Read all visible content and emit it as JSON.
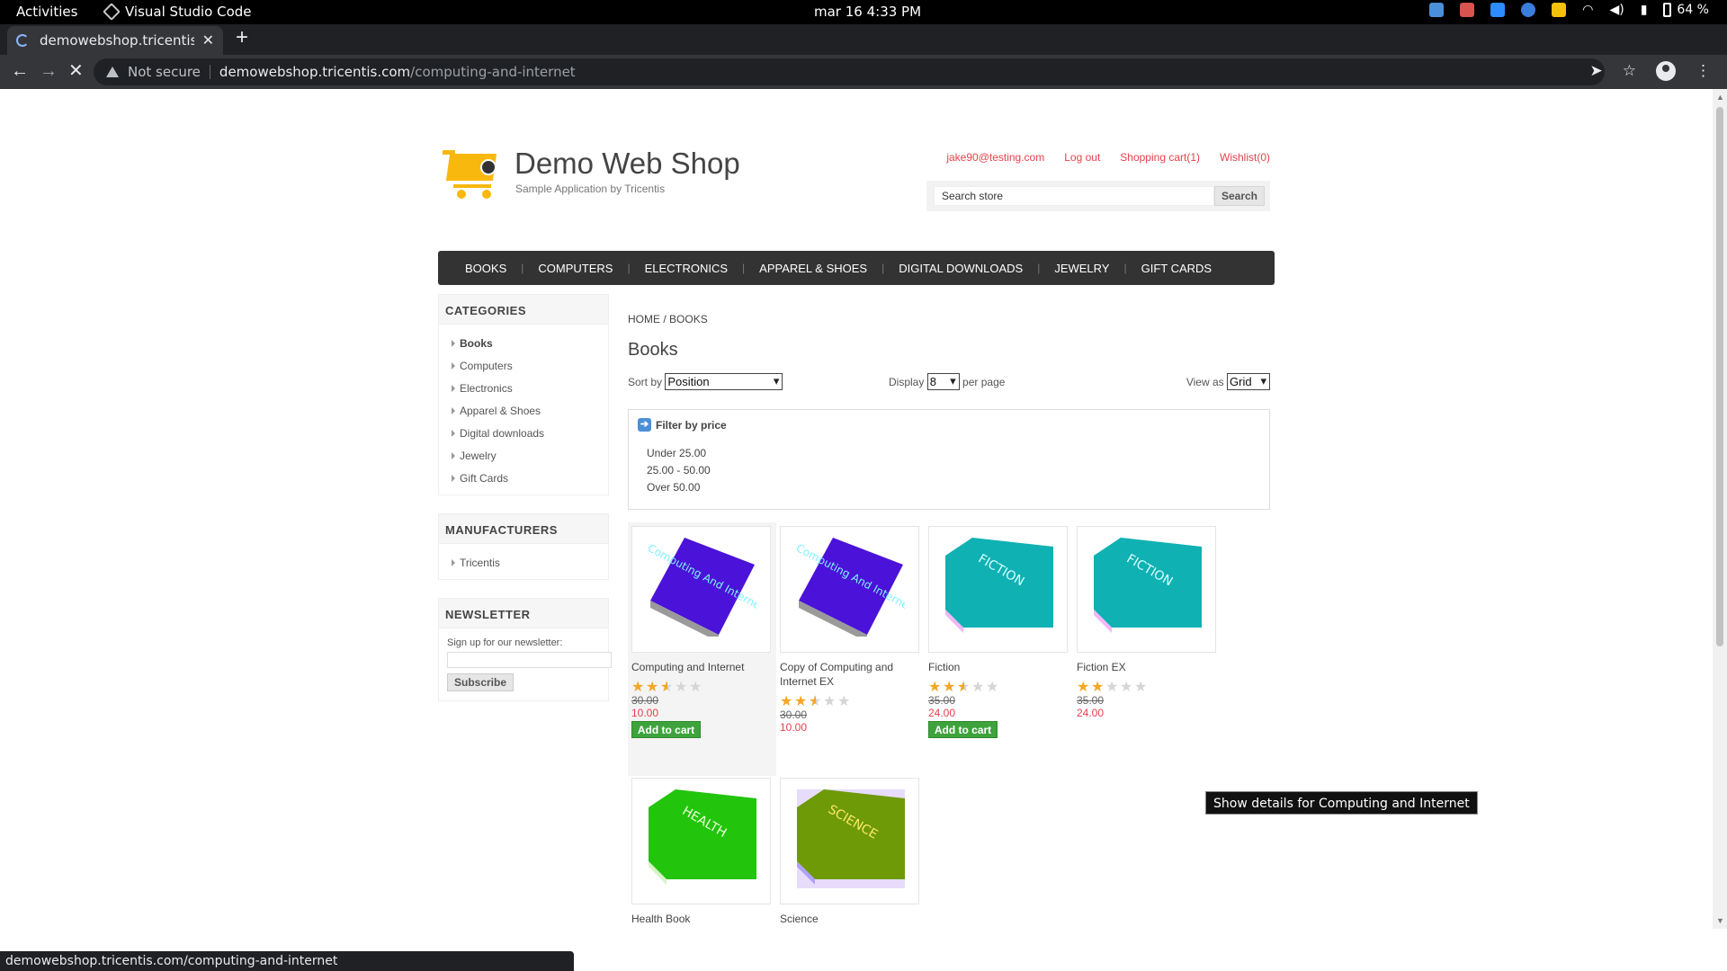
{
  "os": {
    "activities": "Activities",
    "app_name": "Visual Studio Code",
    "clock": "mar 16  4:33 PM",
    "battery": "64 %"
  },
  "browser": {
    "tab_title": "demowebshop.tricentis.com",
    "not_secure": "Not secure",
    "url_host": "demowebshop.tricentis.com",
    "url_path": "/computing-and-internet",
    "status_url": "demowebshop.tricentis.com/computing-and-internet"
  },
  "header": {
    "logo_title": "Demo Web Shop",
    "logo_subtitle": "Sample Application by Tricentis",
    "account": "jake90@testing.com",
    "logout": "Log out",
    "cart": "Shopping cart(1)",
    "wishlist": "Wishlist(0)",
    "search_value": "Search store",
    "search_button": "Search"
  },
  "menu": [
    "BOOKS",
    "COMPUTERS",
    "ELECTRONICS",
    "APPAREL & SHOES",
    "DIGITAL DOWNLOADS",
    "JEWELRY",
    "GIFT CARDS"
  ],
  "categories": {
    "title": "CATEGORIES",
    "items": [
      "Books",
      "Computers",
      "Electronics",
      "Apparel & Shoes",
      "Digital downloads",
      "Jewelry",
      "Gift Cards"
    ]
  },
  "manufacturers": {
    "title": "MANUFACTURERS",
    "items": [
      "Tricentis"
    ]
  },
  "newsletter": {
    "title": "NEWSLETTER",
    "label": "Sign up for our newsletter:",
    "button": "Subscribe"
  },
  "main": {
    "breadcrumb_home": "HOME",
    "breadcrumb_sep": "/",
    "breadcrumb_current": "BOOKS",
    "title": "Books",
    "sort_label": "Sort by",
    "sort_value": "Position",
    "display_label": "Display",
    "display_value": "8",
    "per_page": "per page",
    "viewas_label": "View as",
    "viewas_value": "Grid",
    "filter_title": "Filter by price",
    "filters": [
      "Under 25.00",
      "25.00 - 50.00",
      "Over 50.00"
    ]
  },
  "products": [
    {
      "name": "Computing and Internet",
      "rating": 2.5,
      "old_price": "30.00",
      "price": "10.00",
      "add_to_cart": "Add to cart",
      "cover_color": "#4b12d9",
      "cover_text": "Computing And Internet"
    },
    {
      "name": "Copy of Computing and Internet EX",
      "rating": 2.5,
      "old_price": "30.00",
      "price": "10.00",
      "cover_color": "#4b12d9",
      "cover_text": "Computing And Internet"
    },
    {
      "name": "Fiction",
      "rating": 2.5,
      "old_price": "35.00",
      "price": "24.00",
      "add_to_cart": "Add to cart",
      "cover_color": "#10b1b3",
      "cover_text": "FICTION"
    },
    {
      "name": "Fiction EX",
      "rating": 2,
      "old_price": "35.00",
      "price": "24.00",
      "cover_color": "#10b1b3",
      "cover_text": "FICTION"
    },
    {
      "name": "Health Book",
      "cover_color": "#22c40c",
      "cover_text": "HEALTH"
    },
    {
      "name": "Science",
      "cover_color": "#6e9a08",
      "cover_text": "SCIENCE"
    }
  ],
  "tooltip": "Show details for Computing and Internet"
}
